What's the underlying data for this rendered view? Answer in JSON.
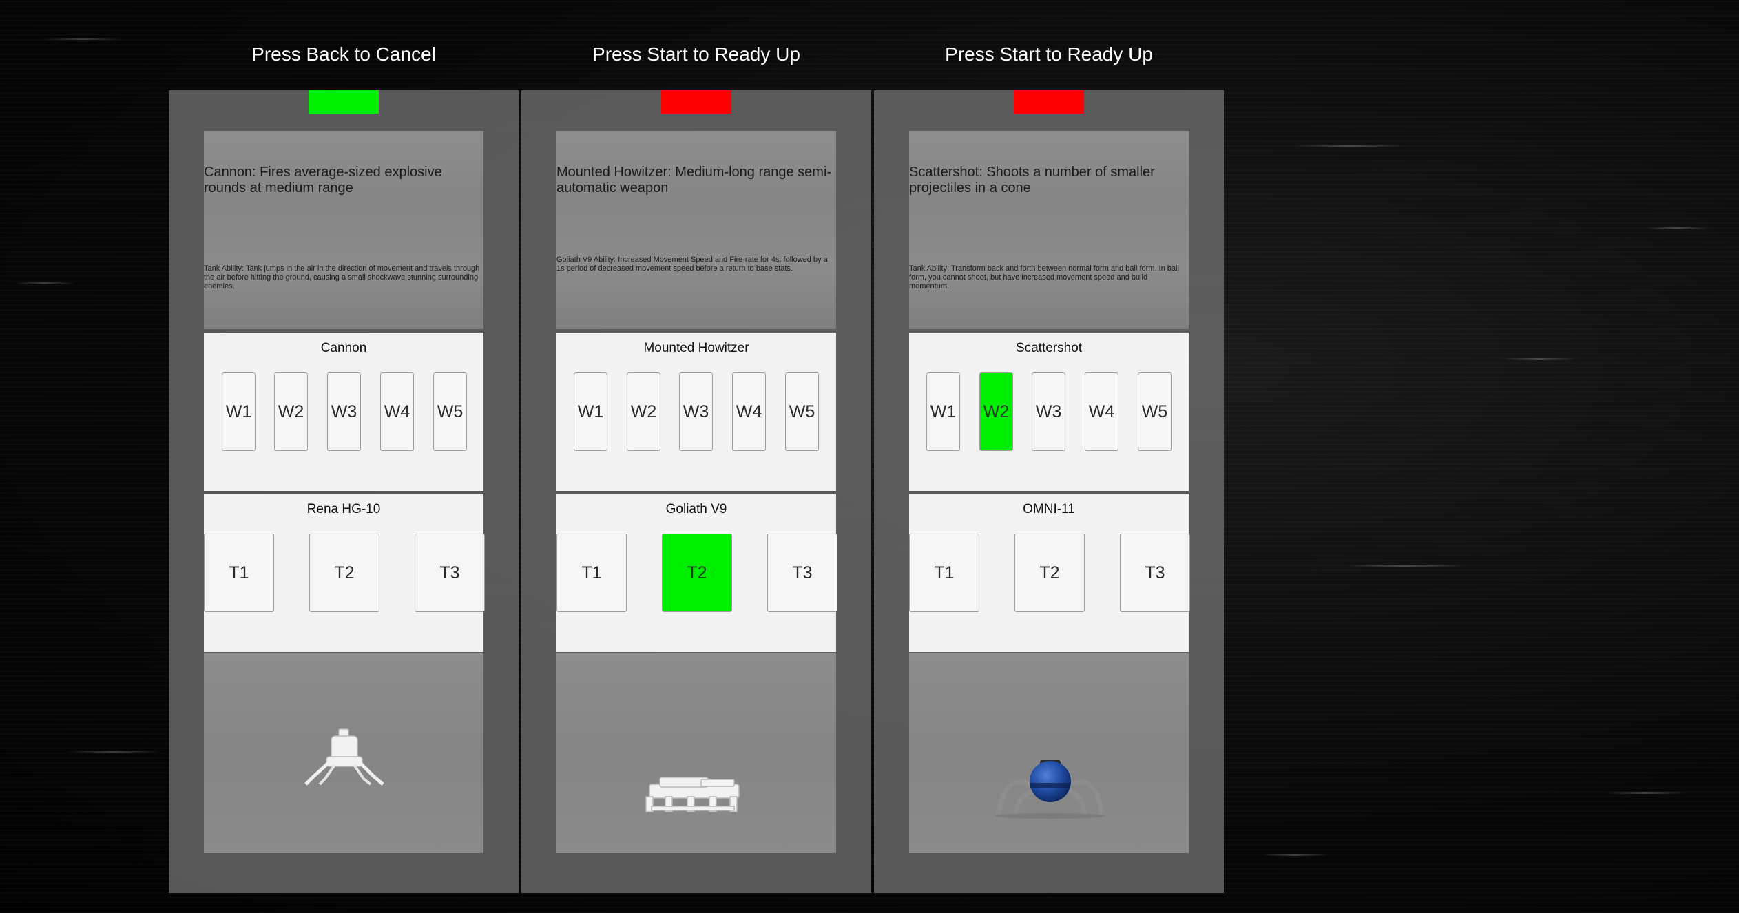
{
  "colors": {
    "ready": "#00ee00",
    "not_ready": "#ff0000",
    "selected": "#00ee00"
  },
  "players": [
    {
      "prompt": "Press Back to Cancel",
      "ready_state": "ready",
      "weapon_description": "Cannon: Fires average-sized explosive rounds at medium range",
      "tank_ability": "Tank Ability: Tank jumps in the air in the direction of movement and travels through the air before hitting the ground, causing a small shockwave stunning surrounding enemies.",
      "weapon_name": "Cannon",
      "weapon_buttons": [
        "W1",
        "W2",
        "W3",
        "W4",
        "W5"
      ],
      "weapon_selected": null,
      "tank_name": "Rena HG-10",
      "tank_buttons": [
        "T1",
        "T2",
        "T3"
      ],
      "tank_selected": null,
      "preview": "walker-tank-model"
    },
    {
      "prompt": "Press Start to Ready Up",
      "ready_state": "not-ready",
      "weapon_description": "Mounted Howitzer: Medium-long range semi-automatic weapon",
      "tank_ability": "Goliath V9 Ability: Increased Movement Speed and Fire-rate for 4s, followed by a 1s period of decreased movement speed before a return to base stats.",
      "weapon_name": "Mounted Howitzer",
      "weapon_buttons": [
        "W1",
        "W2",
        "W3",
        "W4",
        "W5"
      ],
      "weapon_selected": null,
      "tank_name": "Goliath V9",
      "tank_buttons": [
        "T1",
        "T2",
        "T3"
      ],
      "tank_selected": 1,
      "preview": "heavy-tank-model"
    },
    {
      "prompt": "Press Start to Ready Up",
      "ready_state": "not-ready",
      "weapon_description": "Scattershot: Shoots a number of smaller projectiles in a cone",
      "tank_ability": "Tank Ability: Transform back and forth between normal form and ball form. In ball form, you cannot shoot, but have increased movement speed and build momentum.",
      "weapon_name": "Scattershot",
      "weapon_buttons": [
        "W1",
        "W2",
        "W3",
        "W4",
        "W5"
      ],
      "weapon_selected": 1,
      "tank_name": "OMNI-11",
      "tank_buttons": [
        "T1",
        "T2",
        "T3"
      ],
      "tank_selected": null,
      "preview": "spider-ball-tank-model"
    }
  ]
}
